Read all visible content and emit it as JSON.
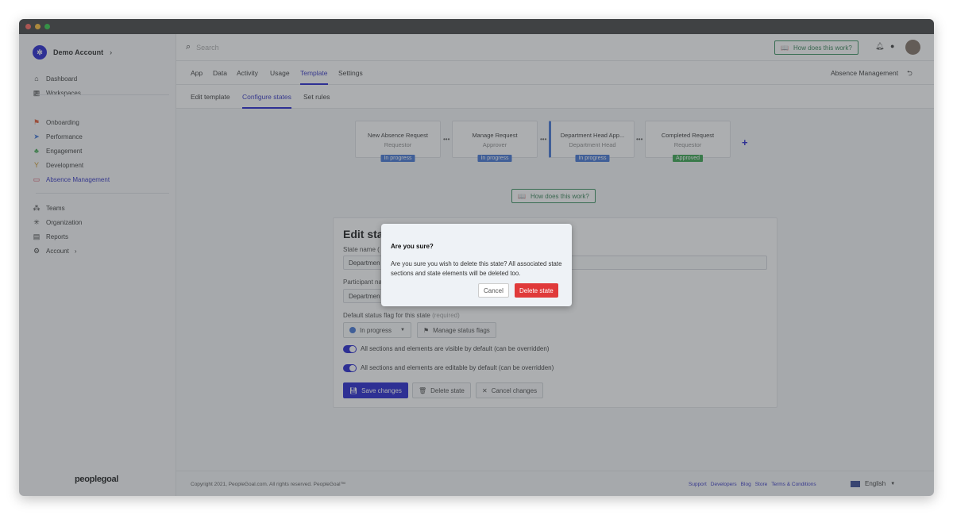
{
  "sidebar": {
    "account": "Demo Account",
    "group1": [
      {
        "label": "Dashboard",
        "icon": "home-icon"
      },
      {
        "label": "Workspaces",
        "icon": "grid-icon"
      }
    ],
    "group2": [
      {
        "label": "Onboarding",
        "icon": "flag-icon"
      },
      {
        "label": "Performance",
        "icon": "rocket-icon"
      },
      {
        "label": "Engagement",
        "icon": "puzzle-icon"
      },
      {
        "label": "Development",
        "icon": "sprout-icon"
      },
      {
        "label": "Absence Management",
        "icon": "laptop-icon",
        "active": true
      }
    ],
    "group3": [
      {
        "label": "Teams",
        "icon": "org-chart-icon"
      },
      {
        "label": "Organization",
        "icon": "network-icon"
      },
      {
        "label": "Reports",
        "icon": "report-icon"
      },
      {
        "label": "Account",
        "icon": "gear-icon"
      }
    ],
    "brand": "peoplegoal"
  },
  "topbar": {
    "search_placeholder": "Search",
    "how": "How does this work?"
  },
  "tabs": [
    "App",
    "Data",
    "Activity",
    "Usage",
    "Template",
    "Settings"
  ],
  "app_name": "Absence Management",
  "subtabs": [
    "Edit template",
    "Configure states",
    "Set rules"
  ],
  "states": [
    {
      "name": "New Absence Request",
      "role": "Requestor",
      "status": "In progress"
    },
    {
      "name": "Manage Request",
      "role": "Approver",
      "status": "In progress"
    },
    {
      "name": "Department Head App...",
      "role": "Department Head",
      "status": "In progress"
    },
    {
      "name": "Completed Request",
      "role": "Requestor",
      "status": "Approved"
    }
  ],
  "colors": {
    "accent": "#1a1acc",
    "in_progress": "#3b6fd4",
    "approved": "#2fa046",
    "danger": "#e03a3a"
  },
  "how_button": "How does this work?",
  "edit": {
    "title": "Edit sta",
    "state_name_label": "State name (",
    "state_name_value": "Departmen",
    "participant_label": "Participant na",
    "participant_value": "Departmen",
    "flag_label": "Default status flag for this state",
    "flag_required": "(required)",
    "flag_value": "In progress",
    "manage_flags": "Manage status flags",
    "toggle_visible": "All sections and elements are visible by default (can be overridden)",
    "toggle_editable": "All sections and elements are editable by default (can be overridden)",
    "save": "Save changes",
    "delete": "Delete state",
    "cancel": "Cancel changes"
  },
  "modal": {
    "title": "Are you sure?",
    "body": "Are you sure you wish to delete this state? All associated state sections and state elements will be deleted too.",
    "cancel": "Cancel",
    "confirm": "Delete state"
  },
  "footer": {
    "copyright": "Copyright 2021, PeopleGoal.com. All rights reserved. PeopleGoal™",
    "links": [
      "Support",
      "Developers",
      "Blog",
      "Store",
      "Terms & Conditions"
    ],
    "language": "English"
  }
}
